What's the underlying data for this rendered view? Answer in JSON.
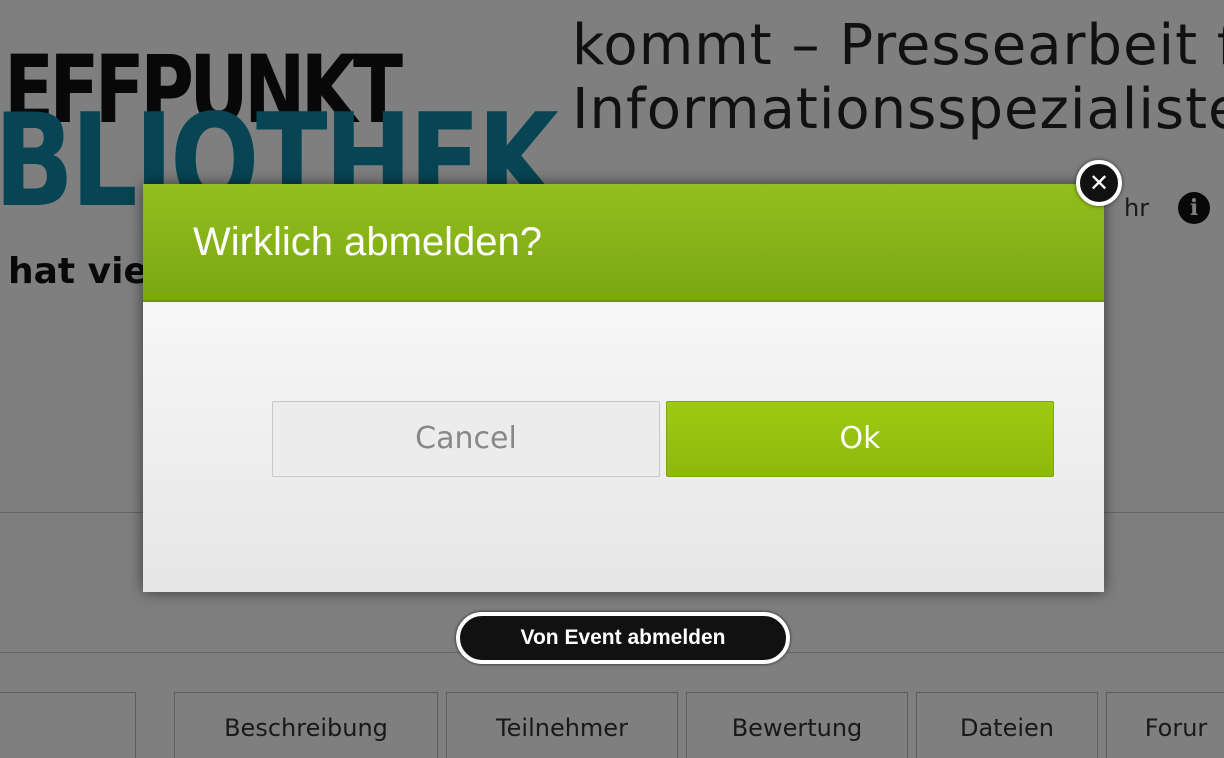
{
  "logo": {
    "line1": "EFFPUNKT",
    "line2": "BLIOTHEK"
  },
  "event": {
    "title_line1": "kommt – Pressearbeit für",
    "title_line2": "Informationsspezialisten“",
    "tagline": "hat vie",
    "time_fragment": "hr"
  },
  "icons": {
    "info": "info-icon",
    "close": "close-icon"
  },
  "tabs": [
    {
      "label": ""
    },
    {
      "label": "Beschreibung"
    },
    {
      "label": "Teilnehmer"
    },
    {
      "label": "Bewertung"
    },
    {
      "label": "Dateien"
    },
    {
      "label": "Forur"
    }
  ],
  "dialog": {
    "title": "Wirklich abmelden?",
    "cancel_label": "Cancel",
    "ok_label": "Ok",
    "close_glyph": "✕"
  },
  "tooltip": {
    "text": "Von Event abmelden"
  },
  "colors": {
    "accent": "#8db80b",
    "header": "#7ba712",
    "logo_blue": "#0e8aa8"
  }
}
